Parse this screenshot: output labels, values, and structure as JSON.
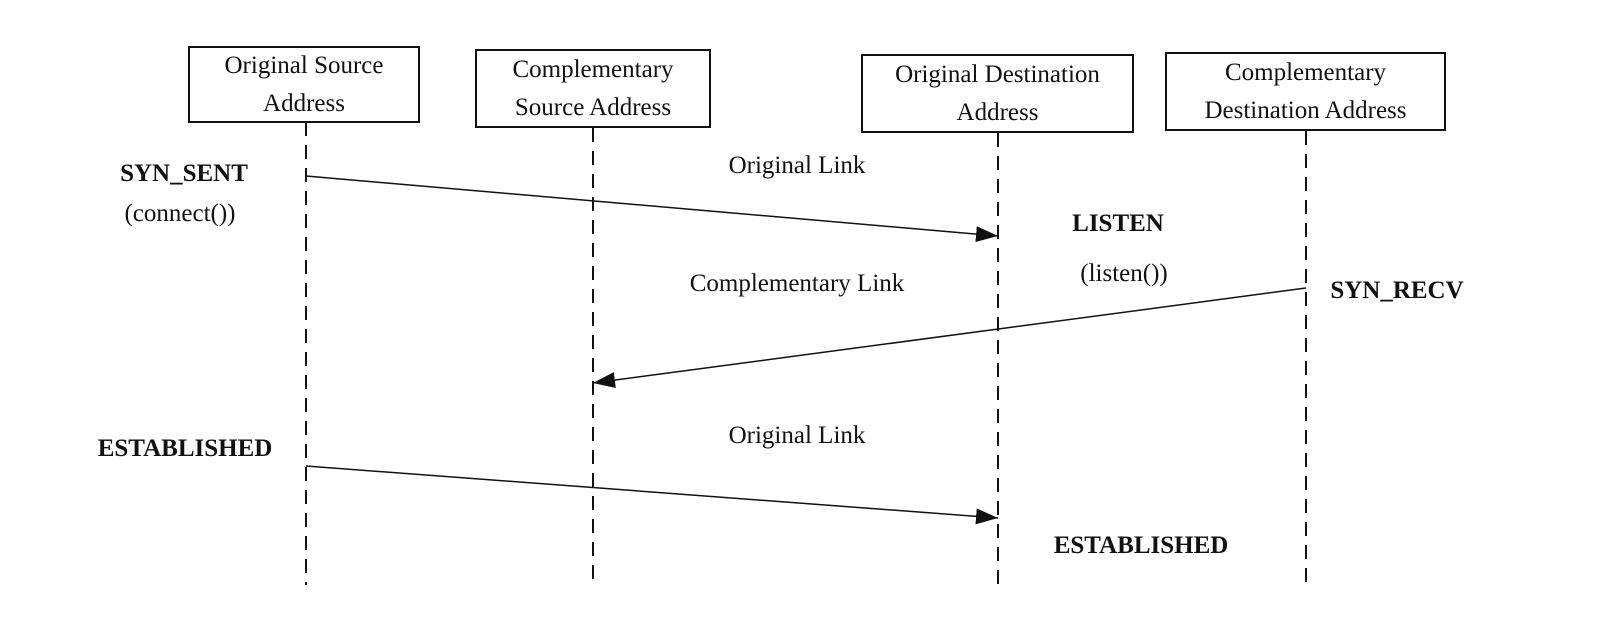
{
  "participants": [
    {
      "line1": "Original Source",
      "line2": "Address"
    },
    {
      "line1": "Complementary",
      "line2": "Source Address"
    },
    {
      "line1": "Original Destination",
      "line2": "Address"
    },
    {
      "line1": "Complementary",
      "line2": "Destination Address"
    }
  ],
  "messages": [
    {
      "label": "Original Link",
      "from": 0,
      "to": 2
    },
    {
      "label": "Complementary Link",
      "from": 3,
      "to": 1
    },
    {
      "label": "Original Link",
      "from": 0,
      "to": 2
    }
  ],
  "states": {
    "syn_sent": "SYN_SENT",
    "connect": "(connect())",
    "listen": "LISTEN",
    "listen_call": "(listen())",
    "syn_recv": "SYN_RECV",
    "established_src": "ESTABLISHED",
    "established_dst": "ESTABLISHED"
  }
}
